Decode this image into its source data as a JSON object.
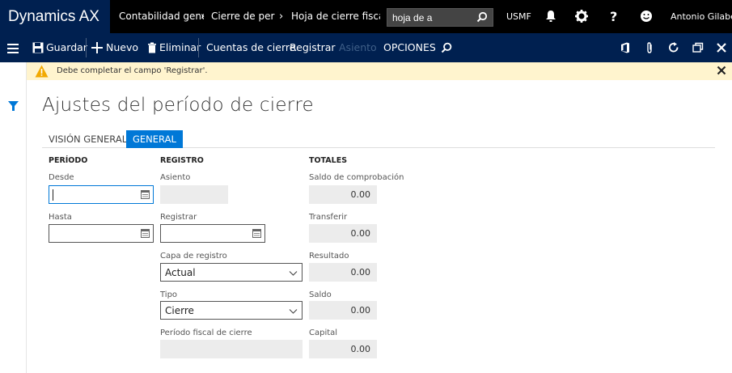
{
  "app": {
    "title": "Dynamics AX"
  },
  "breadcrumb": [
    "Contabilidad gene",
    "Cierre de períoc",
    "Hoja de cierre fiscal"
  ],
  "search": {
    "value": "hoja de a"
  },
  "company": "USMF",
  "user": "Antonio Gilabert",
  "actions": {
    "save": "Guardar",
    "new": "Nuevo",
    "delete": "Eliminar",
    "closing_accounts": "Cuentas de cierre",
    "post": "Registrar",
    "voucher": "Asiento",
    "options": "OPCIONES"
  },
  "message": "Debe completar el campo 'Registrar'.",
  "page": {
    "title": "Ajustes del período de cierre",
    "tabs": [
      "VISIÓN GENERAL",
      "GENERAL"
    ],
    "active_tab": "GENERAL"
  },
  "period": {
    "heading": "PERÍODO",
    "from_label": "Desde",
    "from_value": "",
    "to_label": "Hasta",
    "to_value": ""
  },
  "posting": {
    "heading": "REGISTRO",
    "voucher_label": "Asiento",
    "voucher_value": "",
    "post_label": "Registrar",
    "post_value": "",
    "layer_label": "Capa de registro",
    "layer_value": "Actual",
    "type_label": "Tipo",
    "type_value": "Cierre",
    "fiscal_label": "Período fiscal de cierre",
    "fiscal_value": ""
  },
  "totals": {
    "heading": "TOTALES",
    "trial_balance_label": "Saldo de comprobación",
    "trial_balance_value": "0.00",
    "transfer_label": "Transferir",
    "transfer_value": "0.00",
    "result_label": "Resultado",
    "result_value": "0.00",
    "balance_label": "Saldo",
    "balance_value": "0.00",
    "capital_label": "Capital",
    "capital_value": "0.00"
  },
  "colors": {
    "navy": "#002050",
    "accent": "#0078d7",
    "warning_bg": "#fff4ce"
  }
}
